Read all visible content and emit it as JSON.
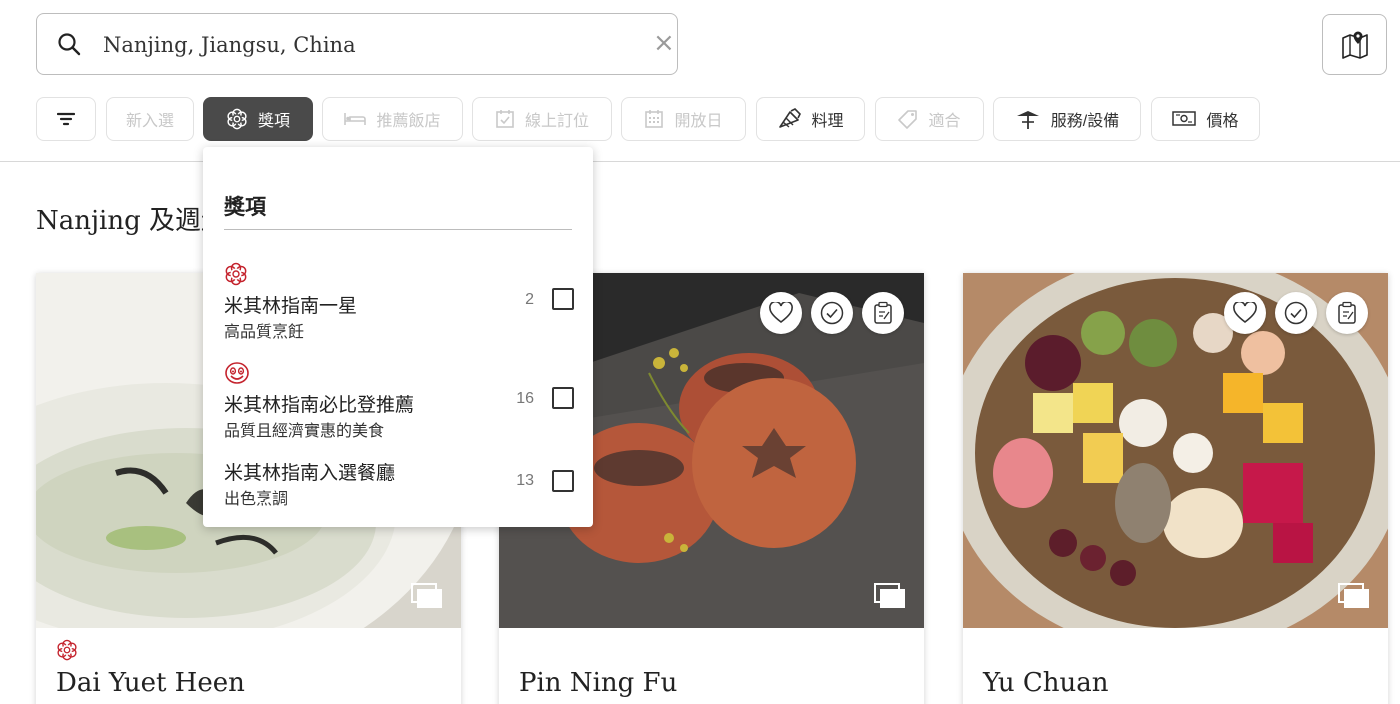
{
  "search": {
    "value": "Nanjing, Jiangsu, China",
    "clear_label": "×"
  },
  "filters": {
    "new_label": "新入選",
    "awards_label": "獎項",
    "hotels_label": "推薦飯店",
    "booking_label": "線上訂位",
    "open_label": "開放日",
    "cuisine_label": "料理",
    "suitable_label": "適合",
    "services_label": "服務/設備",
    "price_label": "價格"
  },
  "section_title": "Nanjing 及週邊",
  "awards_dropdown": {
    "title": "獎項",
    "options": [
      {
        "name": "米其林指南一星",
        "desc": "高品質烹飪",
        "count": "2",
        "icon": "michelin-star-icon"
      },
      {
        "name": "米其林指南必比登推薦",
        "desc": "品質且經濟實惠的美食",
        "count": "16",
        "icon": "bib-gourmand-icon"
      },
      {
        "name": "米其林指南入選餐廳",
        "desc": "出色烹調",
        "count": "13"
      }
    ]
  },
  "cards": [
    {
      "name": "Dai Yuet Heen",
      "award": "michelin-star-icon"
    },
    {
      "name": "Pin Ning Fu"
    },
    {
      "name": "Yu Chuan"
    }
  ],
  "colors": {
    "michelin_red": "#c4232d",
    "active_chip": "#4a4a4a"
  }
}
